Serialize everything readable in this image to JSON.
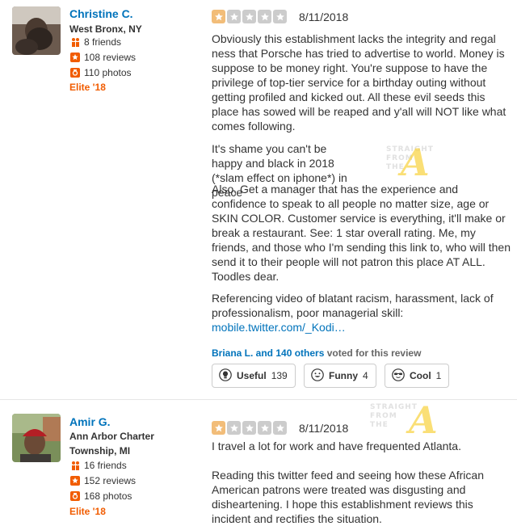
{
  "reviews": [
    {
      "user": {
        "name": "Christine C.",
        "location": "West Bronx, NY",
        "friends": "8 friends",
        "reviews": "108 reviews",
        "photos": "110 photos",
        "elite": "Elite '18"
      },
      "rating": 1,
      "date": "8/11/2018",
      "paragraphs": [
        "Obviously this establishment lacks the integrity and regal ness that Porsche has tried to advertise to world. Money is suppose to be money right. You're suppose to have the privilege of top-tier service for a birthday outing without getting profiled and kicked out. All these evil seeds this place has sowed will be reaped and y'all will NOT like what comes following.",
        "It's shame you can't be happy and black in 2018 (*slam effect on iphone*) in peace",
        "Also, Get a manager that has the experience and confidence to speak to all people no matter size, age or SKIN COLOR. Customer service is everything, it'll make or break a restaurant. See: 1 star overall rating. Me, my friends, and those who I'm sending this link to, who will then send it to their people will not patron this place AT ALL. Toodles dear.",
        "Referencing video of blatant racism, harassment, lack of professionalism, poor managerial skill:"
      ],
      "link": "mobile.twitter.com/_Kodi…",
      "voters": {
        "names": "Briana L. and 140 others",
        "suffix": "voted for this review"
      },
      "buttons": {
        "useful": {
          "label": "Useful",
          "count": "139"
        },
        "funny": {
          "label": "Funny",
          "count": "4"
        },
        "cool": {
          "label": "Cool",
          "count": "1"
        }
      }
    },
    {
      "user": {
        "name": "Amir G.",
        "location": "Ann Arbor Charter Township, MI",
        "friends": "16 friends",
        "reviews": "152 reviews",
        "photos": "168 photos",
        "elite": "Elite '18"
      },
      "rating": 1,
      "date": "8/11/2018",
      "paragraphs": [
        "I travel a lot for work and have frequented Atlanta.",
        "Reading this twitter feed and seeing how these African American patrons were treated was disgusting and disheartening. I hope this establishment reviews this incident and rectifies the situation."
      ]
    }
  ],
  "watermark": {
    "line1": "STRAIGHT",
    "line2": "FROM",
    "line3": "THE",
    "letter": "A"
  },
  "colors": {
    "link": "#0073bb",
    "elite": "#f15c00",
    "star_on": "#f2bd79",
    "star_off": "#cccccc"
  }
}
